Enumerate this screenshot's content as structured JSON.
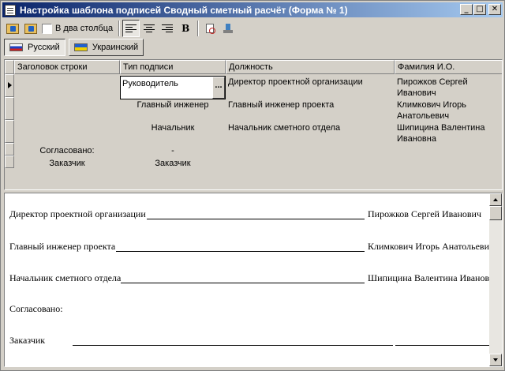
{
  "window": {
    "title": "Настройка шаблона подписей  Сводный сметный расчёт (Форма № 1)",
    "minimize_glyph": "_",
    "maximize_glyph": "□",
    "close_glyph": "✕"
  },
  "toolbar": {
    "two_columns_label": "В два столбца",
    "bold_label": "B",
    "icons": [
      "add-folder-icon",
      "remove-folder-icon",
      "align-left-icon",
      "align-center-icon",
      "align-right-icon",
      "bold-icon",
      "clear-icon",
      "stamp-icon"
    ]
  },
  "language_tabs": [
    {
      "label": "Русский",
      "flag": "russia-flag-icon"
    },
    {
      "label": "Украинский",
      "flag": "ukraine-flag-icon"
    }
  ],
  "grid": {
    "columns": [
      "Заголовок строки",
      "Тип подписи",
      "Должность",
      "Фамилия И.О."
    ],
    "rows": [
      {
        "header": "",
        "type": "Руководитель",
        "position": "Директор проектной организации",
        "name": "Пирожков Сергей Иванович"
      },
      {
        "header": "",
        "type": "Главный инженер",
        "position": "Главный инженер проекта",
        "name": "Климкович Игорь Анатольевич"
      },
      {
        "header": "",
        "type": "Начальник",
        "position": "Начальник сметного отдела",
        "name": "Шипицина Валентина Ивановна"
      },
      {
        "header": "Согласовано:",
        "type": "-",
        "position": "",
        "name": ""
      },
      {
        "header": "Заказчик",
        "type": "Заказчик",
        "position": "",
        "name": ""
      }
    ],
    "editor_button": "..."
  },
  "preview": {
    "lines": [
      {
        "left": "Директор проектной организации",
        "right": "Пирожков Сергей Иванович"
      },
      {
        "left": "Главный инженер проекта",
        "right": "Климкович Игорь Анатольевич"
      },
      {
        "left": "Начальник сметного отдела",
        "right": "Шипицина Валентина Ивановна"
      },
      {
        "left": "Согласовано:",
        "right": ""
      },
      {
        "left": "Заказчик",
        "right": ""
      }
    ]
  }
}
